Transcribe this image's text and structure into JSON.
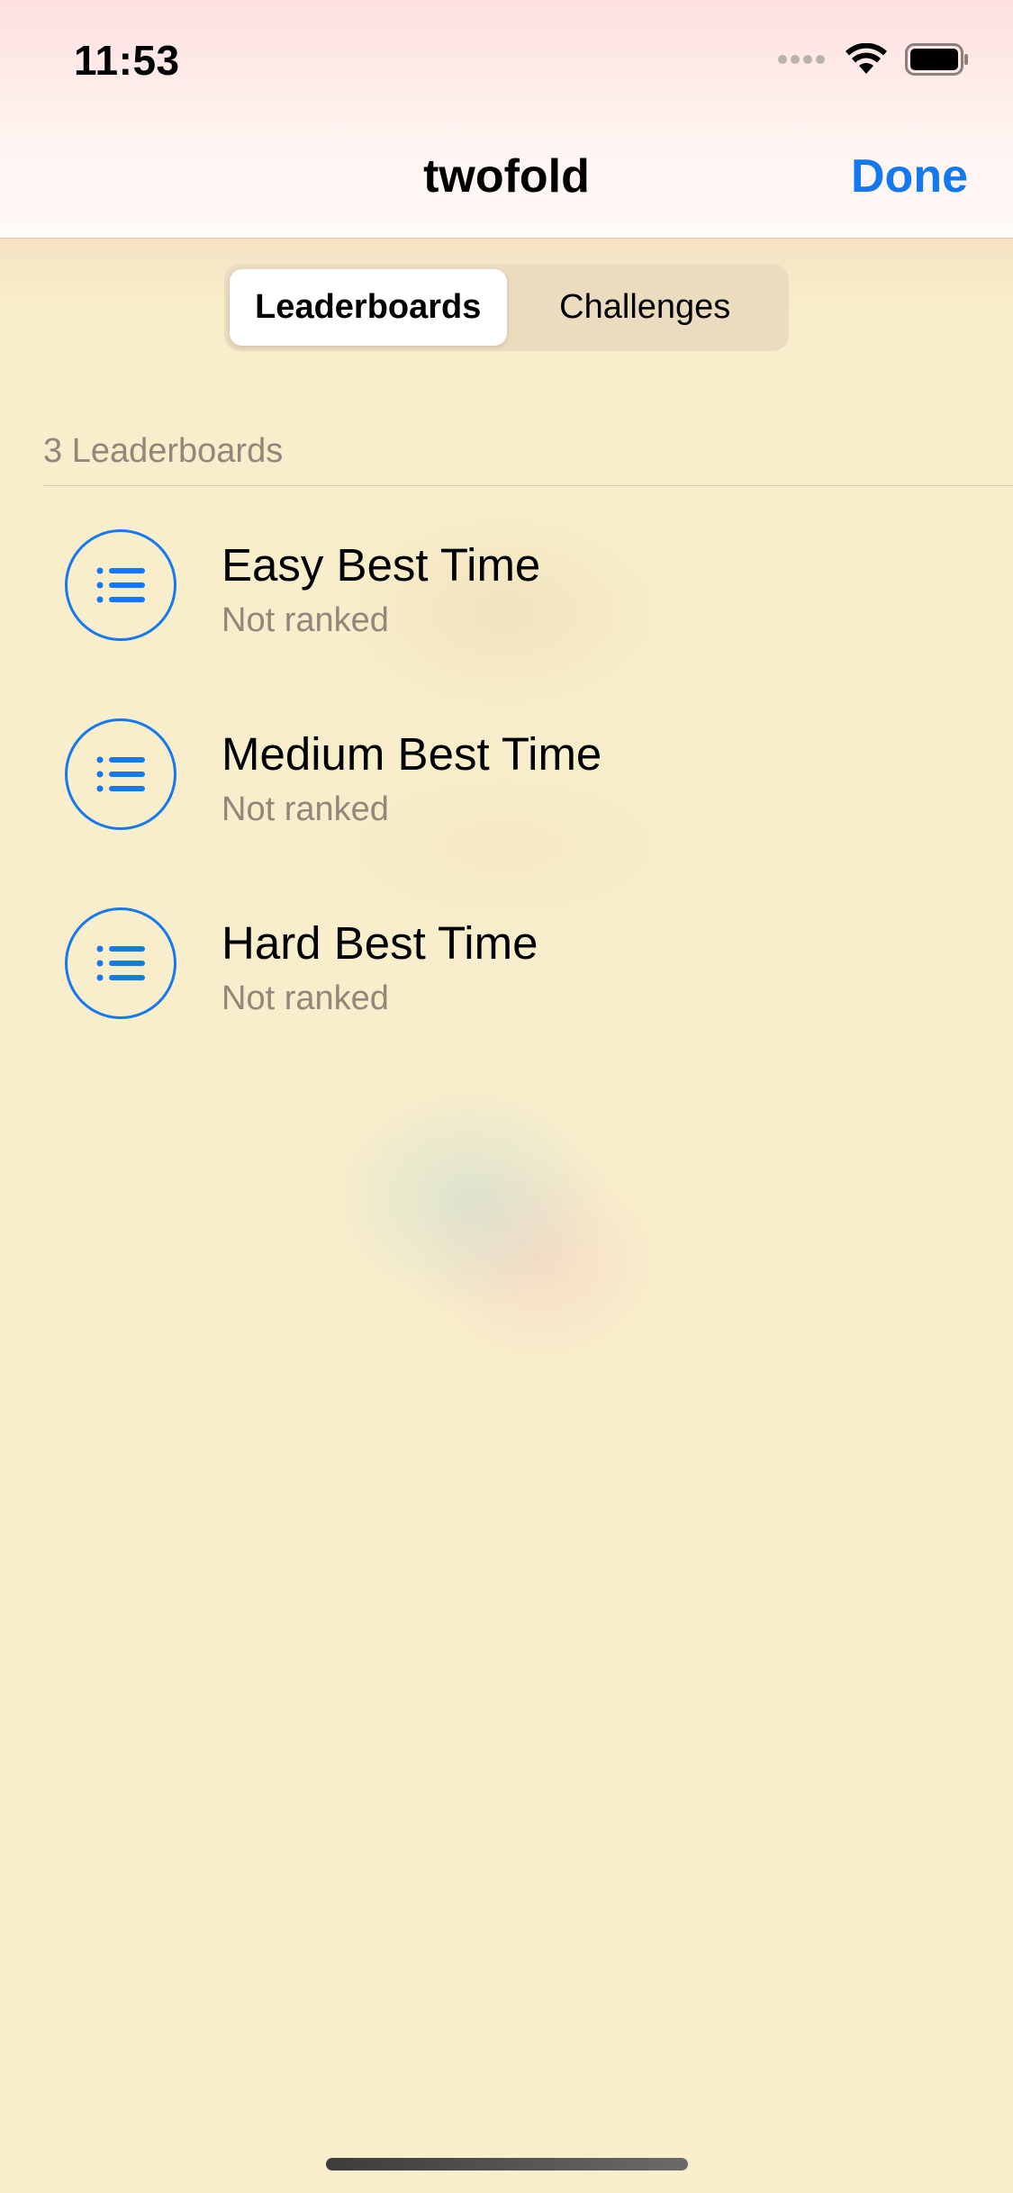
{
  "status_bar": {
    "time": "11:53",
    "signal_icon": "cellular-dots-icon",
    "wifi_icon": "wifi-icon",
    "battery_icon": "battery-icon"
  },
  "nav": {
    "title": "twofold",
    "done_label": "Done"
  },
  "segments": [
    {
      "label": "Leaderboards",
      "selected": true
    },
    {
      "label": "Challenges",
      "selected": false
    }
  ],
  "section": {
    "count_label": "3 Leaderboards"
  },
  "leaderboards": [
    {
      "title": "Easy Best Time",
      "subtitle": "Not ranked",
      "icon": "list-icon"
    },
    {
      "title": "Medium Best Time",
      "subtitle": "Not ranked",
      "icon": "list-icon"
    },
    {
      "title": "Hard Best Time",
      "subtitle": "Not ranked",
      "icon": "list-icon"
    }
  ],
  "colors": {
    "accent": "#1479f0",
    "background": "#f8eecb",
    "secondary_text": "#8f887b"
  }
}
